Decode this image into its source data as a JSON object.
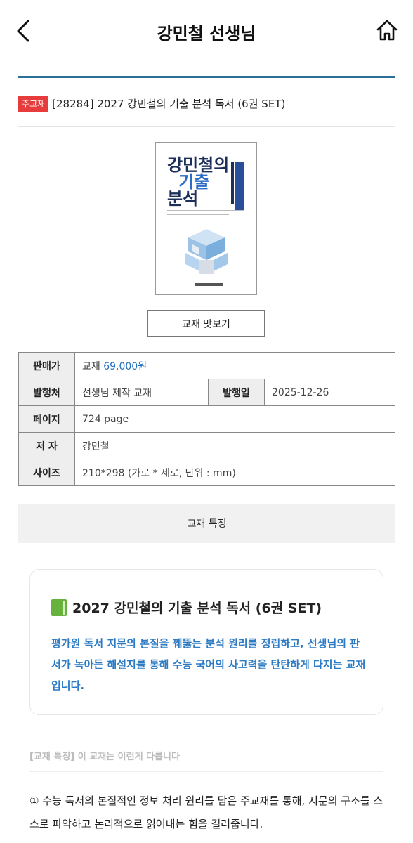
{
  "header": {
    "title": "강민철 선생님",
    "back_icon": "chevron-left-icon",
    "home_icon": "home-icon"
  },
  "product": {
    "badge": "주교재",
    "name": "[28284] 2027 강민철의 기출 분석 독서 (6권 SET)"
  },
  "cover": {
    "title_line1": "강민철의",
    "title_line2": "기출",
    "title_line3": "분석"
  },
  "preview_button": "교재 맛보기",
  "info": {
    "price_label": "판매가",
    "price_prefix": "교재 ",
    "price_value": "69,000원",
    "publisher_label": "발행처",
    "publisher_value": "선생님 제작 교재",
    "date_label": "발행일",
    "date_value": "2025-12-26",
    "pages_label": "페이지",
    "pages_value": "724 page",
    "author_label": "저 자",
    "author_value": "강민철",
    "size_label": "사이즈",
    "size_value": "210*298 (가로 * 세로, 단위 : mm)"
  },
  "feature_tab": "교재 특징",
  "card": {
    "title": "2027 강민철의 기출 분석 독서 (6권 SET)",
    "desc": "평가원 독서 지문의 본질을 꿰뚫는 분석 원리를 정립하고, 선생님의 판서가 녹아든 해설지를 통해 수능 국어의 사고력을 탄탄하게 다지는 교재입니다."
  },
  "faded_heading": "[교재 특징] 이 교재는 이런게 다릅니다",
  "feature_1": "① 수능 독서의 본질적인 정보 처리 원리를 담은 주교재를 통해, 지문의 구조를 스스로 파악하고 논리적으로 읽어내는 힘을 길러줍니다.",
  "colors": {
    "accent_blue": "#2a6f97",
    "badge_red": "#e63c3c",
    "price_blue": "#1e6fc0",
    "desc_blue": "#2d7bc4"
  }
}
